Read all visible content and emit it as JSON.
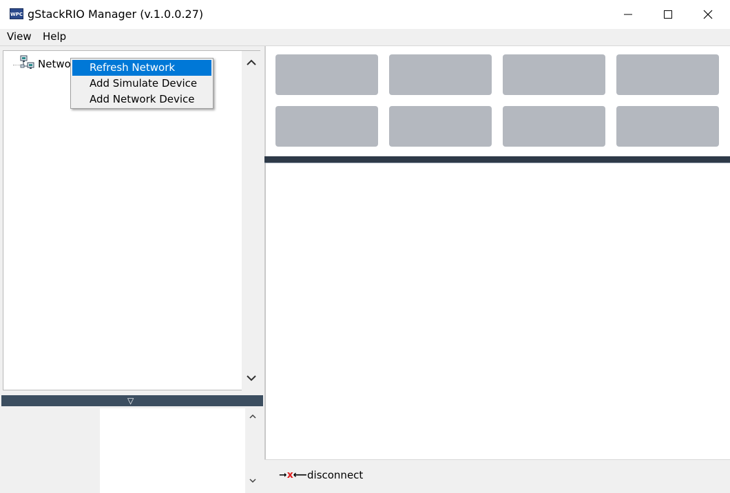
{
  "window": {
    "title": "gStackRIO Manager (v.1.0.0.27)",
    "icon_text": "WPC",
    "controls": [
      "minimize-icon",
      "maximize-icon",
      "close-icon"
    ]
  },
  "menubar": {
    "items": [
      {
        "label": "View"
      },
      {
        "label": "Help"
      }
    ]
  },
  "tree": {
    "root_label": "Network",
    "root_icon": "network-computers-icon"
  },
  "context_menu": {
    "items": [
      {
        "label": "Refresh Network",
        "selected": true
      },
      {
        "label": "Add Simulate Device",
        "selected": false
      },
      {
        "label": "Add Network Device",
        "selected": false
      }
    ]
  },
  "splitter": {
    "arrow": "▽"
  },
  "tiles": {
    "count": 8,
    "color": "#b4b8bf"
  },
  "status": {
    "text": "disconnect",
    "icon": "disconnected-plug-icon"
  },
  "colors": {
    "selection": "#0078d7",
    "splitter": "#3c4e60",
    "dark_bar": "#2e3a48"
  }
}
